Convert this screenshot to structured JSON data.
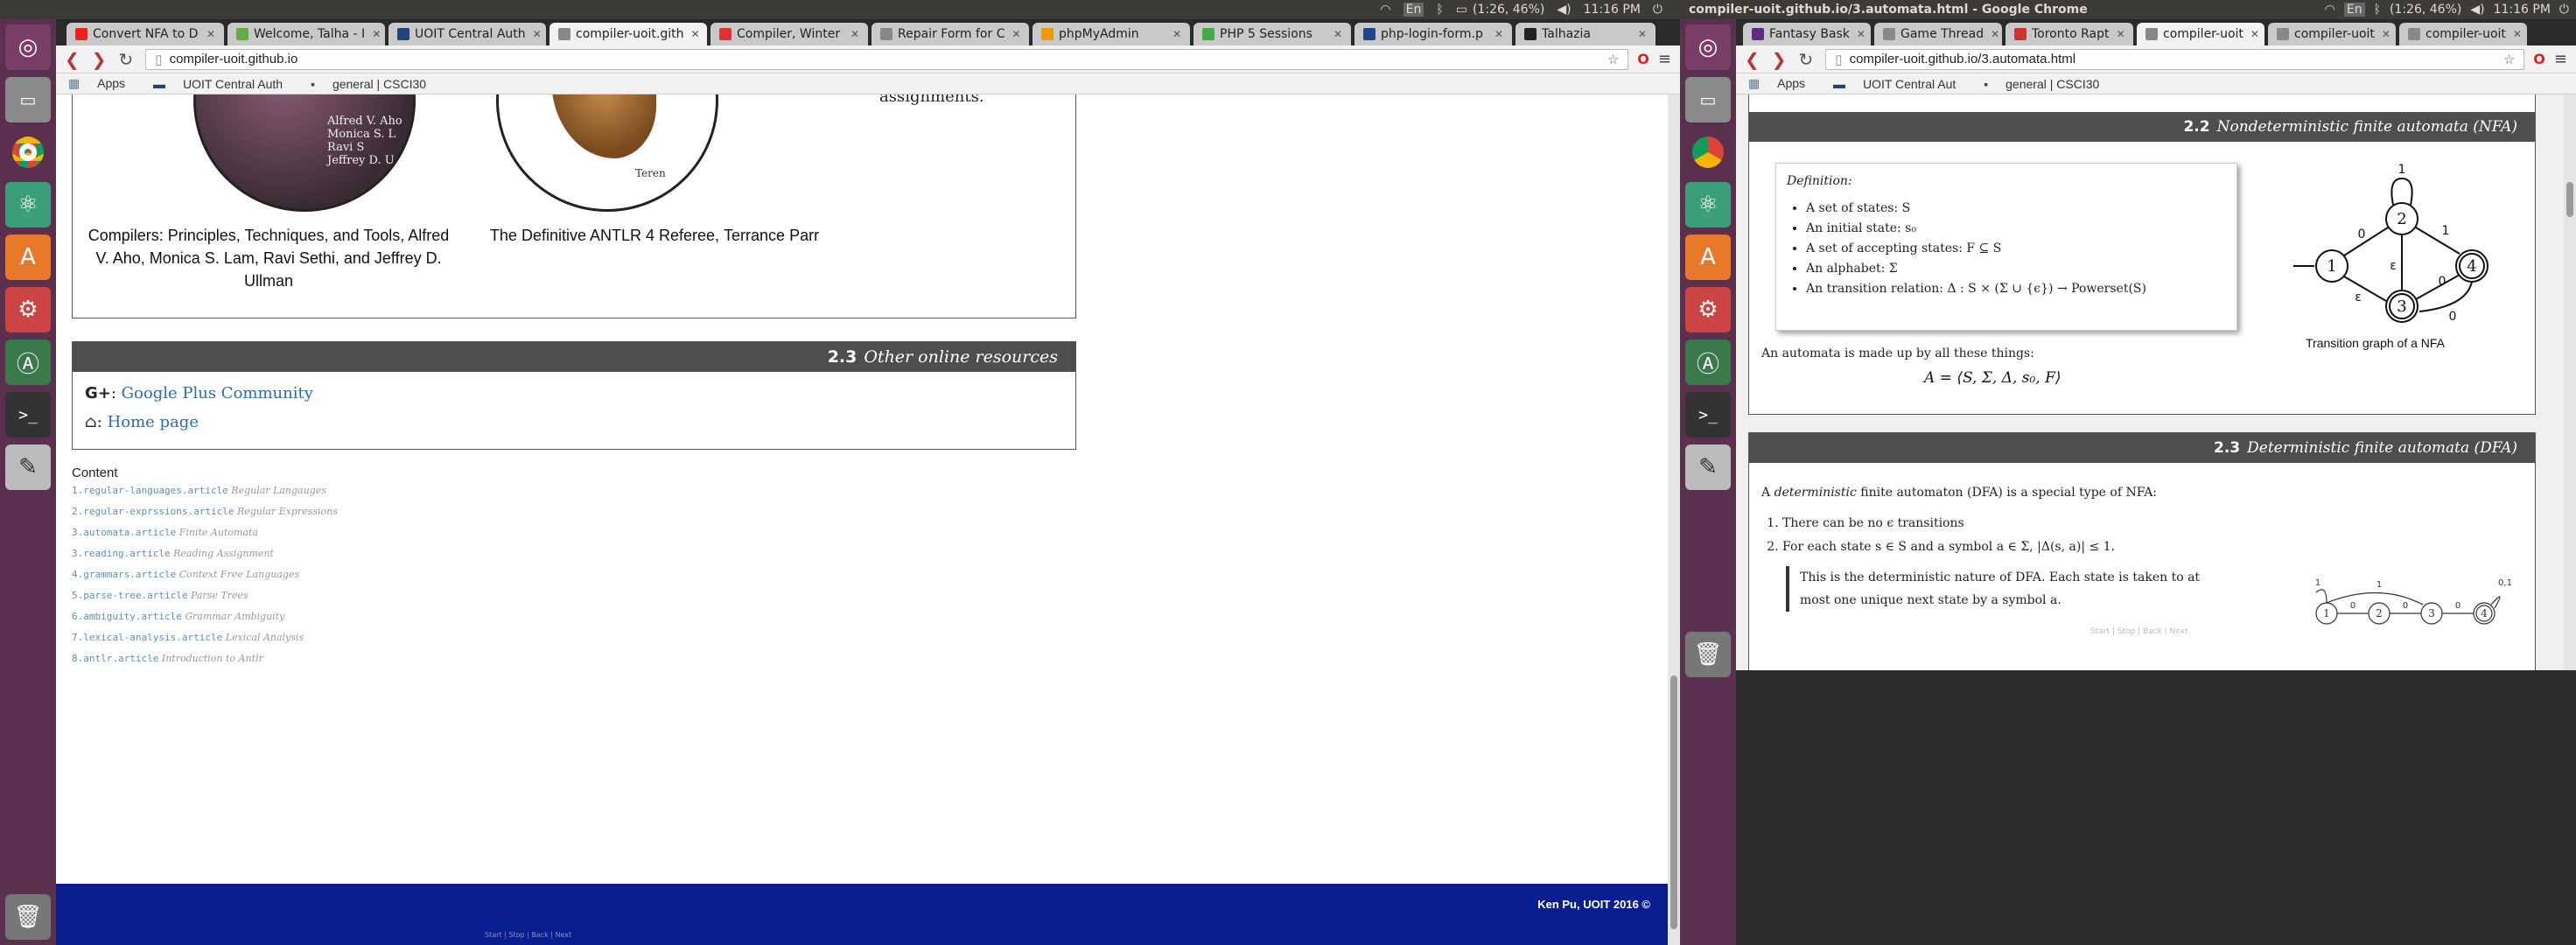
{
  "left": {
    "topbar": {
      "status": "(1:26, 46%)",
      "clock": "11:16 PM"
    },
    "tabs": [
      {
        "label": "Convert NFA to D",
        "color": "#e22"
      },
      {
        "label": "Welcome, Talha - I",
        "color": "#6a4"
      },
      {
        "label": "UOIT Central Auth",
        "color": "#247"
      },
      {
        "label": "compiler-uoit.gith",
        "color": "#888"
      },
      {
        "label": "Compiler, Winter",
        "color": "#d33"
      },
      {
        "label": "Repair Form for C",
        "color": "#888"
      },
      {
        "label": "phpMyAdmin",
        "color": "#e90"
      },
      {
        "label": "PHP 5 Sessions",
        "color": "#4a4"
      },
      {
        "label": "php-login-form.p",
        "color": "#248"
      },
      {
        "label": "Talhazia",
        "color": "#222"
      }
    ],
    "url": "compiler-uoit.github.io",
    "bookmarks": [
      "Apps",
      "UOIT Central Auth",
      "general | CSCI30"
    ],
    "books": {
      "cover1_text": "Alfred V. Aho\nMonica S. L\nRavi S\nJeffrey D. U",
      "cover2_text": "Teren",
      "caption1": "Compilers: Principles, Techniques, and Tools, Alfred V. Aho, Monica S. Lam, Ravi Sethi, and Jeffrey D. Ullman",
      "caption2": "The Definitive ANTLR 4 Refereе, Terrance Parr",
      "side_text": "assignments."
    },
    "resources": {
      "num": "2.3",
      "title": "Other online resources",
      "gplus_prefix": ":",
      "gplus_link": "Google Plus Community",
      "home_prefix": ":",
      "home_link": "Home page"
    },
    "content": {
      "heading": "Content",
      "items": [
        {
          "file": "1.regular-languages.article",
          "desc": "Regular Langauges"
        },
        {
          "file": "2.regular-exprssions.article",
          "desc": "Regular Expressions"
        },
        {
          "file": "3.automata.article",
          "desc": "Finite Automata"
        },
        {
          "file": "3.reading.article",
          "desc": "Reading Assignment"
        },
        {
          "file": "4.grammars.article",
          "desc": "Context Free Languages"
        },
        {
          "file": "5.parse-tree.article",
          "desc": "Parse Trees"
        },
        {
          "file": "6.ambiguity.article",
          "desc": "Grammar Ambiguity"
        },
        {
          "file": "7.lexical-analysis.article",
          "desc": "Lexical Analysis"
        },
        {
          "file": "8.antlr.article",
          "desc": "Introduction to Antlr"
        }
      ]
    },
    "footer": {
      "text": "Ken Pu, UOIT 2016 ©",
      "nav": "Start | Stop | Back | Next"
    }
  },
  "right": {
    "window_title": "compiler-uoit.github.io/3.automata.html - Google Chrome",
    "topbar": {
      "status": "(1:26, 46%)",
      "clock": "11:16 PM"
    },
    "tabs": [
      {
        "label": "Fantasy Bask",
        "color": "#5a2d82"
      },
      {
        "label": "Game Thread",
        "color": "#888"
      },
      {
        "label": "Toronto Rapt",
        "color": "#c33"
      },
      {
        "label": "compiler-uoit",
        "color": "#888"
      },
      {
        "label": "compiler-uoit",
        "color": "#888"
      },
      {
        "label": "compiler-uoit",
        "color": "#888"
      }
    ],
    "url": "compiler-uoit.github.io/3.automata.html",
    "bookmarks": [
      "Apps",
      "UOIT Central Aut",
      "general | CSCI30"
    ],
    "nfa": {
      "num": "2.2",
      "title": "Nondeterministic finite automata (NFA)",
      "def_label": "Definition:",
      "def_items": [
        "A set of states: S",
        "An initial state: s₀",
        "A set of accepting states: F ⊆ S",
        "An alphabet: Σ",
        "An transition relation: Δ : S × (Σ ∪ {ϵ}) → Powerset(S)"
      ],
      "automaton_text": "An automata is made up by all these things:",
      "tuple": "A = ⟨S, Σ, Δ, s₀, F⟩",
      "graph_caption": "Transition graph of a NFA",
      "states": [
        "1",
        "2",
        "3",
        "4"
      ],
      "edge_labels": [
        "1",
        "0",
        "1",
        "ε",
        "ε",
        "0",
        "0"
      ]
    },
    "dfa": {
      "num": "2.3",
      "title": "Deterministic finite automata (DFA)",
      "intro_a": "A",
      "intro_em": "deterministic",
      "intro_b": "finite automaton (DFA) is a special type of NFA:",
      "rules": [
        "There can be no ϵ transitions",
        "For each state s ∈ S and a symbol a ∈ Σ, |Δ(s, a)| ≤ 1."
      ],
      "quote": "This is the deterministic nature of DFA. Each state is taken to at most one unique next state by a symbol a.",
      "nav": "Start | Stop | Back | Next",
      "states": [
        "1",
        "2",
        "3",
        "4"
      ],
      "edge_labels": [
        "1",
        "1",
        "0",
        "0",
        "0",
        "0,1"
      ]
    }
  }
}
